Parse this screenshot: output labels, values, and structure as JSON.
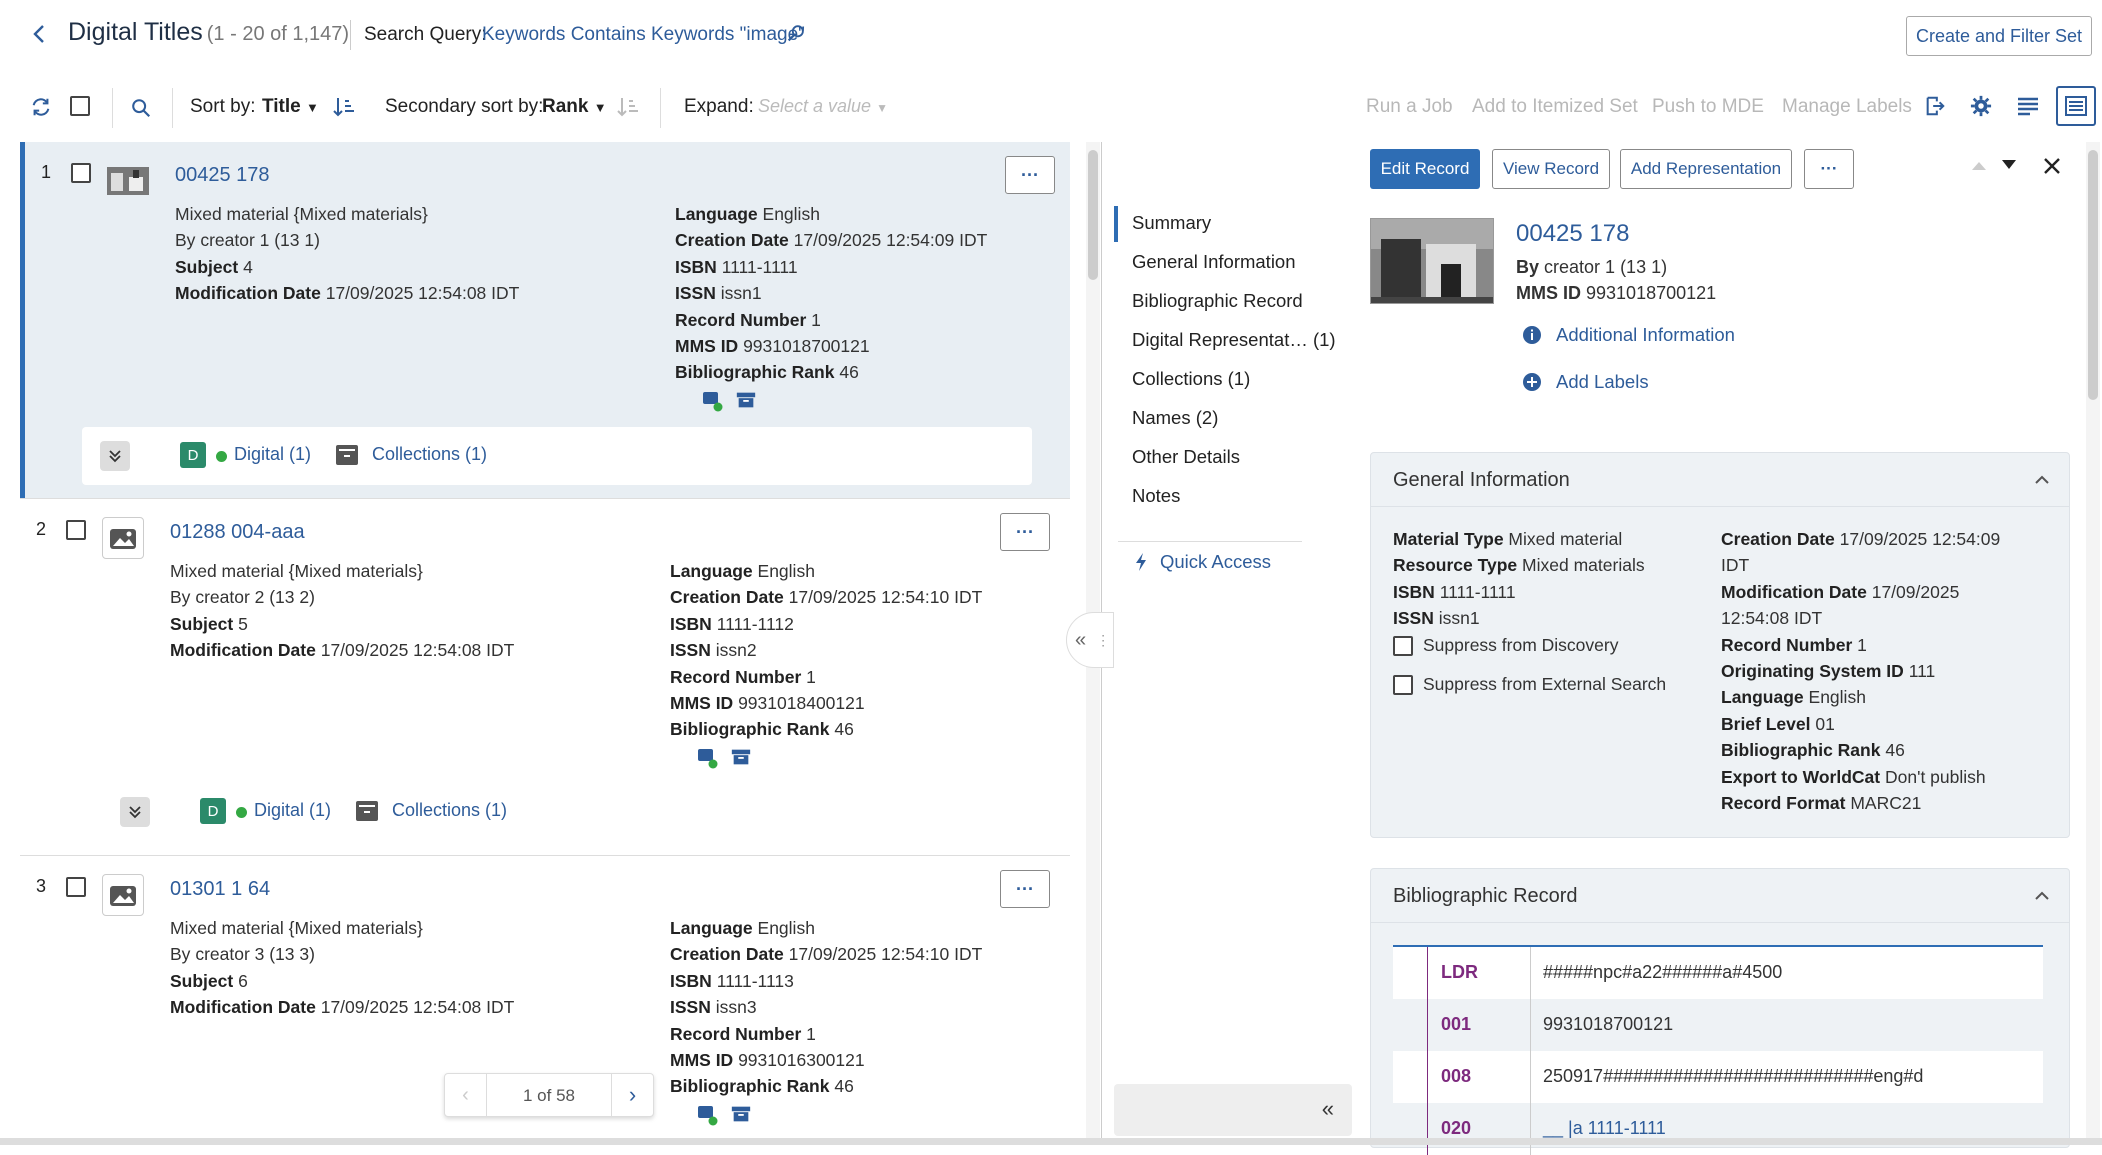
{
  "header": {
    "title": "Digital Titles",
    "count": "(1 - 20 of 1,147)",
    "search_query_label": "Search Query:",
    "search_query_value": "Keywords Contains Keywords \"image\"",
    "create_filter_label": "Create and Filter Set"
  },
  "toolbar": {
    "sort_label": "Sort by:",
    "sort_value": "Title",
    "secondary_sort_label": "Secondary sort by:",
    "secondary_sort_value": "Rank",
    "expand_label": "Expand:",
    "expand_placeholder": "Select a value",
    "actions": [
      "Run a Job",
      "Add to Itemized Set",
      "Push to MDE",
      "Manage Labels"
    ]
  },
  "records": [
    {
      "num": "1",
      "title": "00425 178",
      "left": [
        {
          "k": "",
          "v": "Mixed material {Mixed materials}"
        },
        {
          "k": "By",
          "v": "creator 1 (13 1)"
        },
        {
          "k": "Subject",
          "v": "4"
        },
        {
          "k": "Modification Date",
          "v": "17/09/2025 12:54:08 IDT"
        }
      ],
      "right": [
        {
          "k": "Language",
          "v": "English"
        },
        {
          "k": "Creation Date",
          "v": "17/09/2025 12:54:09 IDT"
        },
        {
          "k": "ISBN",
          "v": "1111-1111"
        },
        {
          "k": "ISSN",
          "v": "issn1"
        },
        {
          "k": "Record Number",
          "v": "1"
        },
        {
          "k": "MMS ID",
          "v": "9931018700121"
        },
        {
          "k": "Bibliographic Rank",
          "v": "46"
        }
      ],
      "digital": "Digital (1)",
      "collections": "Collections (1)",
      "badge": "D"
    },
    {
      "num": "2",
      "title": "01288 004-aaa",
      "left": [
        {
          "k": "",
          "v": "Mixed material {Mixed materials}"
        },
        {
          "k": "By",
          "v": "creator 2 (13 2)"
        },
        {
          "k": "Subject",
          "v": "5"
        },
        {
          "k": "Modification Date",
          "v": "17/09/2025 12:54:08 IDT"
        }
      ],
      "right": [
        {
          "k": "Language",
          "v": "English"
        },
        {
          "k": "Creation Date",
          "v": "17/09/2025 12:54:10 IDT"
        },
        {
          "k": "ISBN",
          "v": "1111-1112"
        },
        {
          "k": "ISSN",
          "v": "issn2"
        },
        {
          "k": "Record Number",
          "v": "1"
        },
        {
          "k": "MMS ID",
          "v": "9931018400121"
        },
        {
          "k": "Bibliographic Rank",
          "v": "46"
        }
      ],
      "digital": "Digital (1)",
      "collections": "Collections (1)",
      "badge": "D"
    },
    {
      "num": "3",
      "title": "01301 1 64",
      "left": [
        {
          "k": "",
          "v": "Mixed material {Mixed materials}"
        },
        {
          "k": "By",
          "v": "creator 3 (13 3)"
        },
        {
          "k": "Subject",
          "v": "6"
        },
        {
          "k": "Modification Date",
          "v": "17/09/2025 12:54:08 IDT"
        }
      ],
      "right": [
        {
          "k": "Language",
          "v": "English"
        },
        {
          "k": "Creation Date",
          "v": "17/09/2025 12:54:10 IDT"
        },
        {
          "k": "ISBN",
          "v": "1111-1113"
        },
        {
          "k": "ISSN",
          "v": "issn3"
        },
        {
          "k": "Record Number",
          "v": "1"
        },
        {
          "k": "MMS ID",
          "v": "9931016300121"
        },
        {
          "k": "Bibliographic Rank",
          "v": "46"
        }
      ]
    }
  ],
  "pager": {
    "text": "1 of 58"
  },
  "details": {
    "buttons": {
      "edit": "Edit Record",
      "view": "View Record",
      "add_rep": "Add Representation"
    },
    "nav": [
      "Summary",
      "General Information",
      "Bibliographic Record",
      "Digital Representat… (1)",
      "Collections (1)",
      "Names (2)",
      "Other Details",
      "Notes"
    ],
    "quick_access": "Quick Access",
    "title": "00425 178",
    "by": "creator 1 (13 1)",
    "by_label": "By",
    "mms_label": "MMS ID",
    "mms": "9931018700121",
    "additional_info": "Additional Information",
    "add_labels": "Add Labels",
    "general": {
      "title": "General Information",
      "left": [
        {
          "k": "Material Type",
          "v": "Mixed material"
        },
        {
          "k": "Resource Type",
          "v": "Mixed materials"
        },
        {
          "k": "ISBN",
          "v": "1111-1111"
        },
        {
          "k": "ISSN",
          "v": "issn1"
        }
      ],
      "checks": [
        "Suppress from Discovery",
        "Suppress from External Search"
      ],
      "right": [
        {
          "k": "Creation Date",
          "v": "17/09/2025 12:54:09"
        },
        {
          "k": "",
          "v": "IDT"
        },
        {
          "k": "Modification Date",
          "v": "17/09/2025"
        },
        {
          "k": "",
          "v": "12:54:08 IDT"
        },
        {
          "k": "Record Number",
          "v": "1"
        },
        {
          "k": "Originating System ID",
          "v": "111"
        },
        {
          "k": "Language",
          "v": "English"
        },
        {
          "k": "Brief Level",
          "v": "01"
        },
        {
          "k": "Bibliographic Rank",
          "v": "46"
        },
        {
          "k": "Export to WorldCat",
          "v": " Don't publish"
        },
        {
          "k": "Record Format",
          "v": "MARC21"
        }
      ]
    },
    "biblio": {
      "title": "Bibliographic Record",
      "rows": [
        {
          "tag": "LDR",
          "val": "#####npc#a22######a#4500"
        },
        {
          "tag": "001",
          "val": "9931018700121"
        },
        {
          "tag": "008",
          "val": "250917###########################eng#d"
        },
        {
          "tag": "020",
          "val": "__ |a 1111-1111"
        }
      ]
    }
  },
  "colors": {
    "accent": "#2e6db4",
    "link": "#2e5c9a",
    "marc_tag": "#7d2a7e",
    "digital_badge": "#2b8a6a",
    "available_dot": "#34a843"
  }
}
